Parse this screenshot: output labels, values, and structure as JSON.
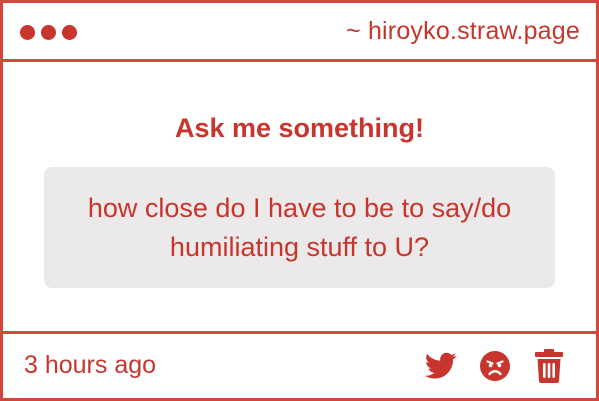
{
  "window": {
    "site_label": "~ hiroyko.straw.page"
  },
  "main": {
    "heading": "Ask me something!",
    "question": "how close do I have to be to say/do humiliating stuff to U?"
  },
  "footer": {
    "timestamp": "3 hours ago",
    "actions": [
      {
        "icon": "twitter-icon"
      },
      {
        "icon": "angry-face-icon"
      },
      {
        "icon": "trash-icon"
      }
    ]
  },
  "colors": {
    "accent": "#c8352d",
    "border": "#d2463c",
    "question_bg": "#ebe9e9",
    "background": "#ffffff"
  }
}
